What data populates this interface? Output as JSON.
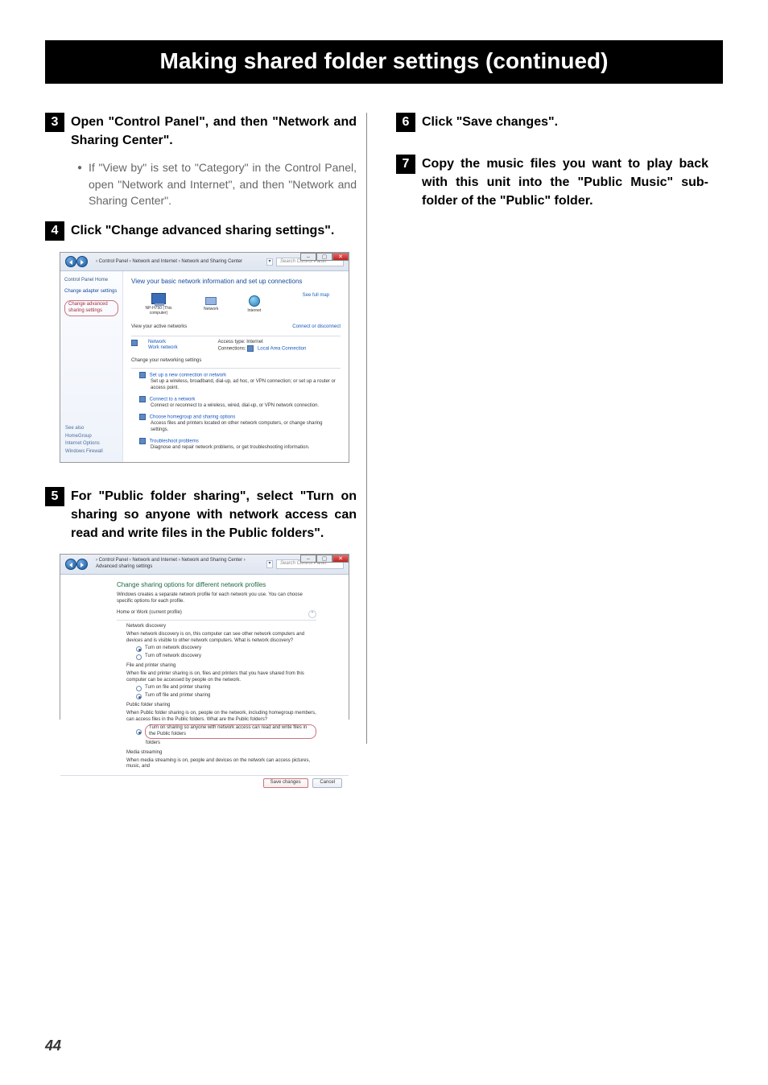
{
  "page_number": "44",
  "title": "Making shared folder settings (continued)",
  "left": {
    "step3_num": "3",
    "step3": "Open \"Control Panel\", and then \"Network and Sharing Center\".",
    "step3_bullet": "If \"View by\" is set to \"Category\" in the Control Panel, open \"Network and Internet\", and then \"Network and Sharing Center\".",
    "step4_num": "4",
    "step4": "Click \"Change advanced sharing settings\".",
    "step5_num": "5",
    "step5": "For \"Public folder sharing\", select \"Turn on sharing so anyone with network access can read and write files in the Public folders\"."
  },
  "right": {
    "step6_num": "6",
    "step6": "Click \"Save changes\".",
    "step7_num": "7",
    "step7": "Copy the music files you want to play back with this unit into the \"Public Music\" sub-folder of the \"Public\" folder."
  },
  "shot1": {
    "path": " › Control Panel › Network and Internet › Network and Sharing Center",
    "search": "Search Control Panel",
    "side_h": "Control Panel Home",
    "side1": "Change adapter settings",
    "side2": "Change advanced sharing settings",
    "heading": "View your basic network information and set up connections",
    "full_map": "See full map",
    "pc": "NP-H750\n(This computer)",
    "net": "Network",
    "inet": "Internet",
    "active": "View your active networks",
    "conn_disc": "Connect or disconnect",
    "net2": "Network",
    "work": "Work network",
    "access": "Access type:",
    "access_v": "Internet",
    "conns": "Connections:",
    "conns_v": "Local Area Connection",
    "change_h": "Change your networking settings",
    "i1t": "Set up a new connection or network",
    "i1d": "Set up a wireless, broadband, dial-up, ad hoc, or VPN connection; or set up a router or access point.",
    "i2t": "Connect to a network",
    "i2d": "Connect or reconnect to a wireless, wired, dial-up, or VPN network connection.",
    "i3t": "Choose homegroup and sharing options",
    "i3d": "Access files and printers located on other network computers, or change sharing settings.",
    "i4t": "Troubleshoot problems",
    "i4d": "Diagnose and repair network problems, or get troubleshooting information.",
    "see_also": "See also",
    "f1": "HomeGroup",
    "f2": "Internet Options",
    "f3": "Windows Firewall"
  },
  "shot2": {
    "path": " › Control Panel › Network and Internet › Network and Sharing Center › Advanced sharing settings",
    "search": "Search Control Panel",
    "h1": "Change sharing options for different network profiles",
    "p1": "Windows creates a separate network profile for each network you use. You can choose specific options for each profile.",
    "profile": "Home or Work (current profile)",
    "nd": "Network discovery",
    "nd_d": "When network discovery is on, this computer can see other network computers and devices and is visible to other network computers. What is network discovery?",
    "nd1": "Turn on network discovery",
    "nd2": "Turn off network discovery",
    "fp": "File and printer sharing",
    "fp_d": "When file and printer sharing is on, files and printers that you have shared from this computer can be accessed by people on the network.",
    "fp1": "Turn on file and printer sharing",
    "fp2": "Turn off file and printer sharing",
    "pf": "Public folder sharing",
    "pf_d": "When Public folder sharing is on, people on the network, including homegroup members, can access files in the Public folders. What are the Public folders?",
    "pf1": "Turn on sharing so anyone with network access can read and write files in the Public folders",
    "pf2": "folders",
    "ms": "Media streaming",
    "ms_d": "When media streaming is on, people and devices on the network can access pictures, music, and",
    "save": "Save changes",
    "cancel": "Cancel"
  }
}
